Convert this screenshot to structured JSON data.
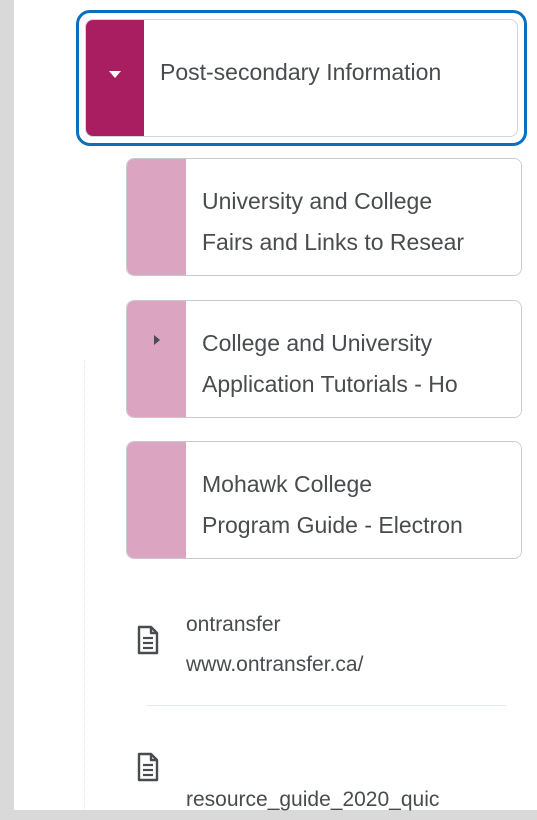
{
  "module": {
    "title": "Post-secondary Information",
    "expanded": true,
    "accent_color": "#a81e61",
    "focus_color": "#0b6fbf"
  },
  "submodules": [
    {
      "line1": "University and College",
      "line2": "Fairs and Links to Resear",
      "has_children": false
    },
    {
      "line1": "College and University",
      "line2": "Application Tutorials - Ho",
      "has_children": true
    },
    {
      "line1": "Mohawk College",
      "line2": "Program Guide - Electron",
      "has_children": false
    }
  ],
  "submodule_accent_color": "#dba5c2",
  "documents": [
    {
      "icon": "document-icon",
      "title": "ontransfer",
      "url": "www.ontransfer.ca/"
    },
    {
      "icon": "document-icon",
      "title": "resource_guide_2020_quic"
    }
  ]
}
